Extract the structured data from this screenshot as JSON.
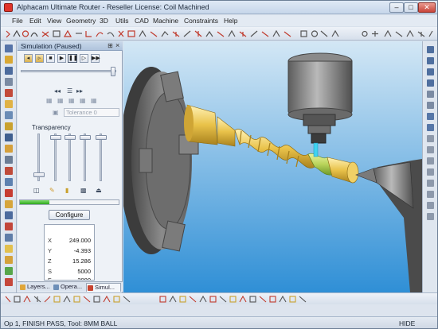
{
  "window": {
    "title": "Alphacam Ultimate Router - Reseller License: Coil Machined"
  },
  "menu": [
    "File",
    "Edit",
    "View",
    "Geometry",
    "3D",
    "Utils",
    "CAD",
    "Machine",
    "Constraints",
    "Help"
  ],
  "simulation_panel": {
    "title": "Simulation (Paused)",
    "tolerance_placeholder": "Tolerance  0",
    "transparency_label": "Transparency",
    "configure_label": "Configure",
    "progress_fraction": 0.3,
    "coordinates": [
      {
        "axis": "X",
        "value": "249.000"
      },
      {
        "axis": "Y",
        "value": "-4.393"
      },
      {
        "axis": "Z",
        "value": "15.286"
      },
      {
        "axis": "S",
        "value": "5000"
      },
      {
        "axis": "F",
        "value": "2000"
      }
    ],
    "tabs": [
      {
        "label": "Layers...",
        "color": "#e0a63a"
      },
      {
        "label": "Opera...",
        "color": "#6d8fb8"
      },
      {
        "label": "Simul...",
        "color": "#c7432f"
      }
    ]
  },
  "status": {
    "text": "Op 1, FINISH PASS, Tool: 8MM BALL",
    "right": "HIDE"
  },
  "colors": {
    "viewport_top": "#cde3f3",
    "viewport_bottom": "#2f8fd6",
    "workpiece": "#e9c24a",
    "machined_zone": "#b9d35a",
    "chuck": "#7c7c7c"
  }
}
